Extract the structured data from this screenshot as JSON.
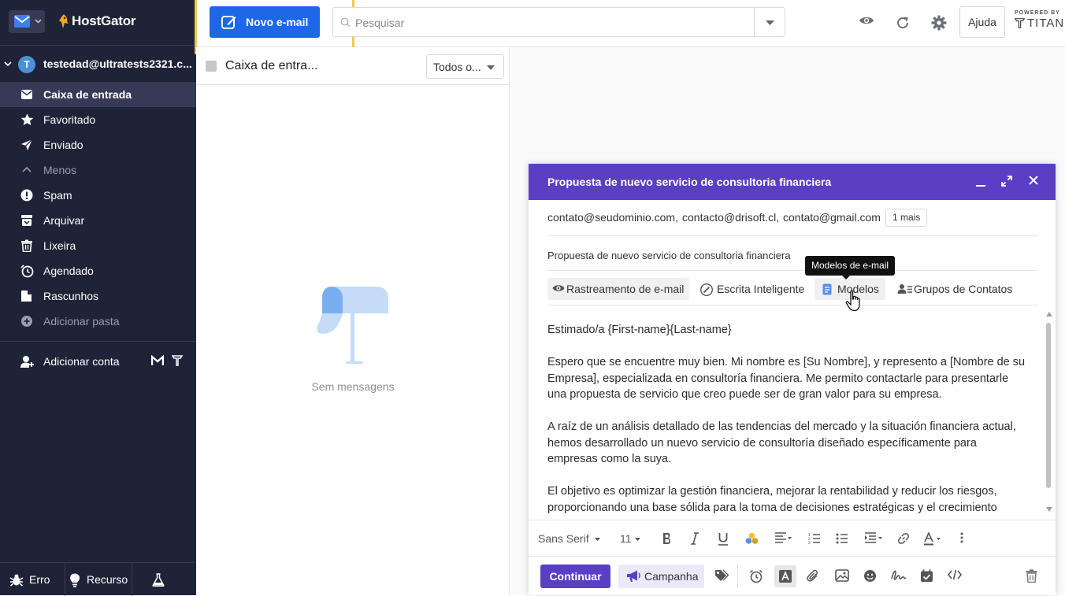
{
  "brand": {
    "name": "HostGator"
  },
  "account": {
    "initial": "T",
    "email": "testedad@ultratests2321.c..."
  },
  "folders": [
    {
      "label": "Caixa de entrada",
      "icon": "inbox-icon"
    },
    {
      "label": "Favoritado",
      "icon": "star-icon"
    },
    {
      "label": "Enviado",
      "icon": "send-icon"
    },
    {
      "label": "Menos",
      "icon": "chevron-up-icon"
    },
    {
      "label": "Spam",
      "icon": "spam-icon"
    },
    {
      "label": "Arquivar",
      "icon": "archive-icon"
    },
    {
      "label": "Lixeira",
      "icon": "trash-icon"
    },
    {
      "label": "Agendado",
      "icon": "scheduled-icon"
    },
    {
      "label": "Rascunhos",
      "icon": "drafts-icon"
    },
    {
      "label": "Adicionar pasta",
      "icon": "add-folder-icon"
    }
  ],
  "add_account": {
    "label": "Adicionar conta"
  },
  "footer": {
    "error_label": "Erro",
    "feature_label": "Recurso"
  },
  "topbar": {
    "new_email_label": "Novo e-mail",
    "search_placeholder": "Pesquisar",
    "help_label": "Ajuda",
    "powered_by": "POWERED BY",
    "titan": "TITAN"
  },
  "list": {
    "title": "Caixa de entra...",
    "filter_label": "Todos o...",
    "empty_text": "Sem mensagens"
  },
  "compose": {
    "title": "Propuesta de nuevo servicio de consultoria financiera",
    "recipients": [
      "contato@seudominio.com,",
      "contacto@drisoft.cl,",
      "contato@gmail.com"
    ],
    "more_label": "1 mais",
    "subject": "Propuesta de nuevo servicio de consultoria financiera",
    "tooltip": "Modelos de e-mail",
    "tools": {
      "tracking": "Rastreamento de e-mail",
      "smart_write": "Escrita Inteligente",
      "templates": "Modelos",
      "contact_groups": "Grupos de Contatos"
    },
    "body": [
      "Estimado/a {First-name}{Last-name}",
      "Espero que se encuentre muy bien. Mi nombre es [Su Nombre], y represento a [Nombre de su Empresa], especializada en consultoría financiera. Me permito contactarle para presentarle una propuesta de servicio que creo puede ser de gran valor para su empresa.",
      "A raíz de un análisis detallado de las tendencias del mercado y la situación financiera actual, hemos desarrollado un nuevo servicio de consultoría diseñado específicamente para empresas como la suya.",
      "El objetivo es optimizar la gestión financiera, mejorar la rentabilidad y reducir los riesgos, proporcionando una base sólida para la toma de decisiones estratégicas y el crecimiento"
    ],
    "format": {
      "font": "Sans Serif",
      "size": "11"
    },
    "send_label": "Continuar",
    "campaign_label": "Campanha"
  },
  "colors": {
    "sidebar": "#1f2337",
    "primary": "#1e68e8",
    "compose_header": "#5a3fc4",
    "highlight": "#f2c84b"
  }
}
